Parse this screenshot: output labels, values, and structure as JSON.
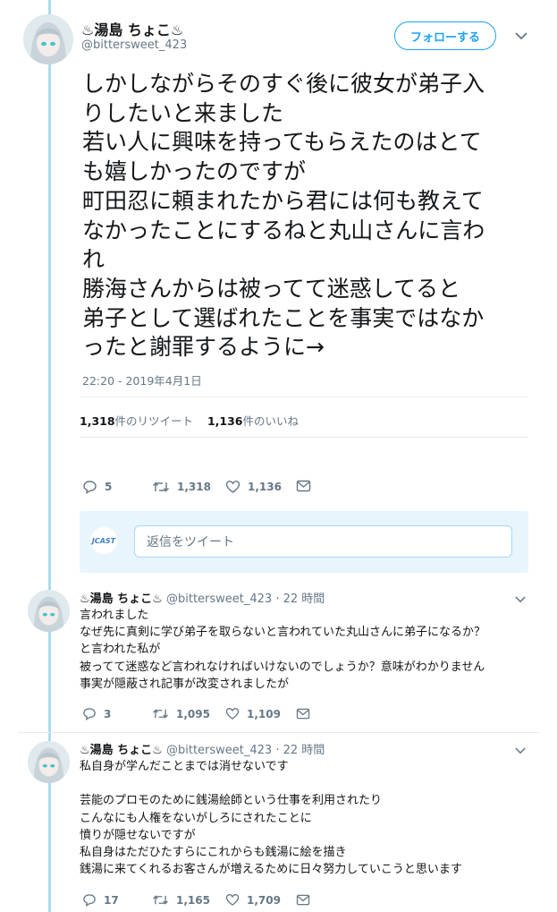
{
  "main_tweet": {
    "display_name": "♨湯島 ちょこ♨",
    "handle": "@bittersweet_423",
    "follow_label": "フォローする",
    "text_lines": [
      "しかしながらそのすぐ後に彼女が弟子入",
      "りしたいと来ました",
      "若い人に興味を持ってもらえたのはとて",
      "も嬉しかったのですが",
      "町田忍に頼まれたから君には何も教えて",
      "なかったことにするねと丸山さんに言わ",
      "れ",
      "勝海さんからは被ってて迷惑してると",
      "弟子として選ばれたことを事実ではなか",
      "ったと謝罪するように→"
    ],
    "timestamp": "22:20 - 2019年4月1日",
    "retweet_count": "1,318",
    "retweet_label": "件のリツイート",
    "like_count": "1,136",
    "like_label": "件のいいね",
    "actions": {
      "replies": "5",
      "retweets": "1,318",
      "likes": "1,136"
    }
  },
  "reply_box": {
    "avatar_label": "JCAST",
    "placeholder": "返信をツイート"
  },
  "replies": [
    {
      "display_name": "♨湯島 ちょこ♨",
      "handle": "@bittersweet_423",
      "time": "· 22 時間",
      "text_lines": [
        "言われました",
        "なぜ先に真剣に学び弟子を取らないと言われていた丸山さんに弟子になるか？",
        "と言われた私が",
        "被ってて迷惑など言われなければいけないのでしょうか？意味がわかりません",
        "事実が隠蔽され記事が改変されましたが"
      ],
      "actions": {
        "replies": "3",
        "retweets": "1,095",
        "likes": "1,109"
      }
    },
    {
      "display_name": "♨湯島 ちょこ♨",
      "handle": "@bittersweet_423",
      "time": "· 22 時間",
      "text_lines": [
        "私自身が学んだことまでは消せないです",
        "",
        "芸能のプロモのために銭湯絵師という仕事を利用されたり",
        "こんなにも人権をないがしろにされたことに",
        "憤りが隠せないですが",
        "私自身はただひたすらにこれからも銭湯に絵を描き",
        "銭湯に来てくれるお客さんが増えるために日々努力していこうと思います"
      ],
      "actions": {
        "replies": "17",
        "retweets": "1,165",
        "likes": "1,709"
      }
    }
  ],
  "colors": {
    "accent": "#1da1f2",
    "thread_line": "#a9dcec",
    "muted": "#657786",
    "hot_spring": "#e0245e"
  }
}
